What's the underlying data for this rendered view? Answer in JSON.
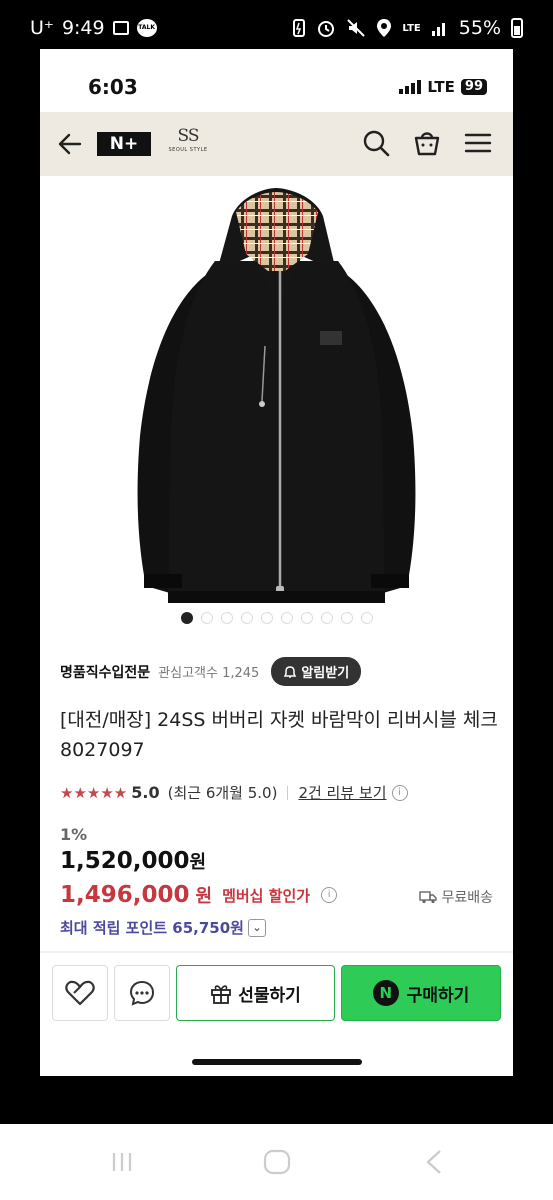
{
  "outer_status": {
    "carrier": "U⁺",
    "time": "9:49",
    "talk_badge": "TALK",
    "lte": "LTE",
    "battery": "55%"
  },
  "inner_status": {
    "time": "6:03",
    "network": "LTE",
    "battery": "99"
  },
  "header": {
    "logo_text": "N+",
    "brand_logo": "SS",
    "brand_sub": "SEOUL STYLE"
  },
  "gallery": {
    "dot_count": 10,
    "active_index": 0
  },
  "seller": {
    "name": "명품직수입전문",
    "fans_label": "관심고객수 1,245",
    "alarm_label": "알림받기"
  },
  "product": {
    "title": "[대전/매장] 24SS 버버리 자켓 바람막이 리버시블 체크 8027097",
    "stars": "★★★★★",
    "score": "5.0",
    "recent": "(최근 6개월 5.0)",
    "review_link": "2건 리뷰 보기",
    "discount": "1%",
    "price_original": "1,520,000",
    "won": "원",
    "price_member": "1,496,000",
    "member_label": "멤버십 할인가",
    "free_shipping": "무료배송",
    "points": "최대 적립 포인트 65,750원"
  },
  "actions": {
    "gift_label": "선물하기",
    "buy_label": "구매하기",
    "buy_badge": "N"
  },
  "colors": {
    "header_bg": "#efeae1",
    "price_red": "#c7373f",
    "points_purple": "#4d4a9c",
    "buy_green": "#2ecc57"
  }
}
